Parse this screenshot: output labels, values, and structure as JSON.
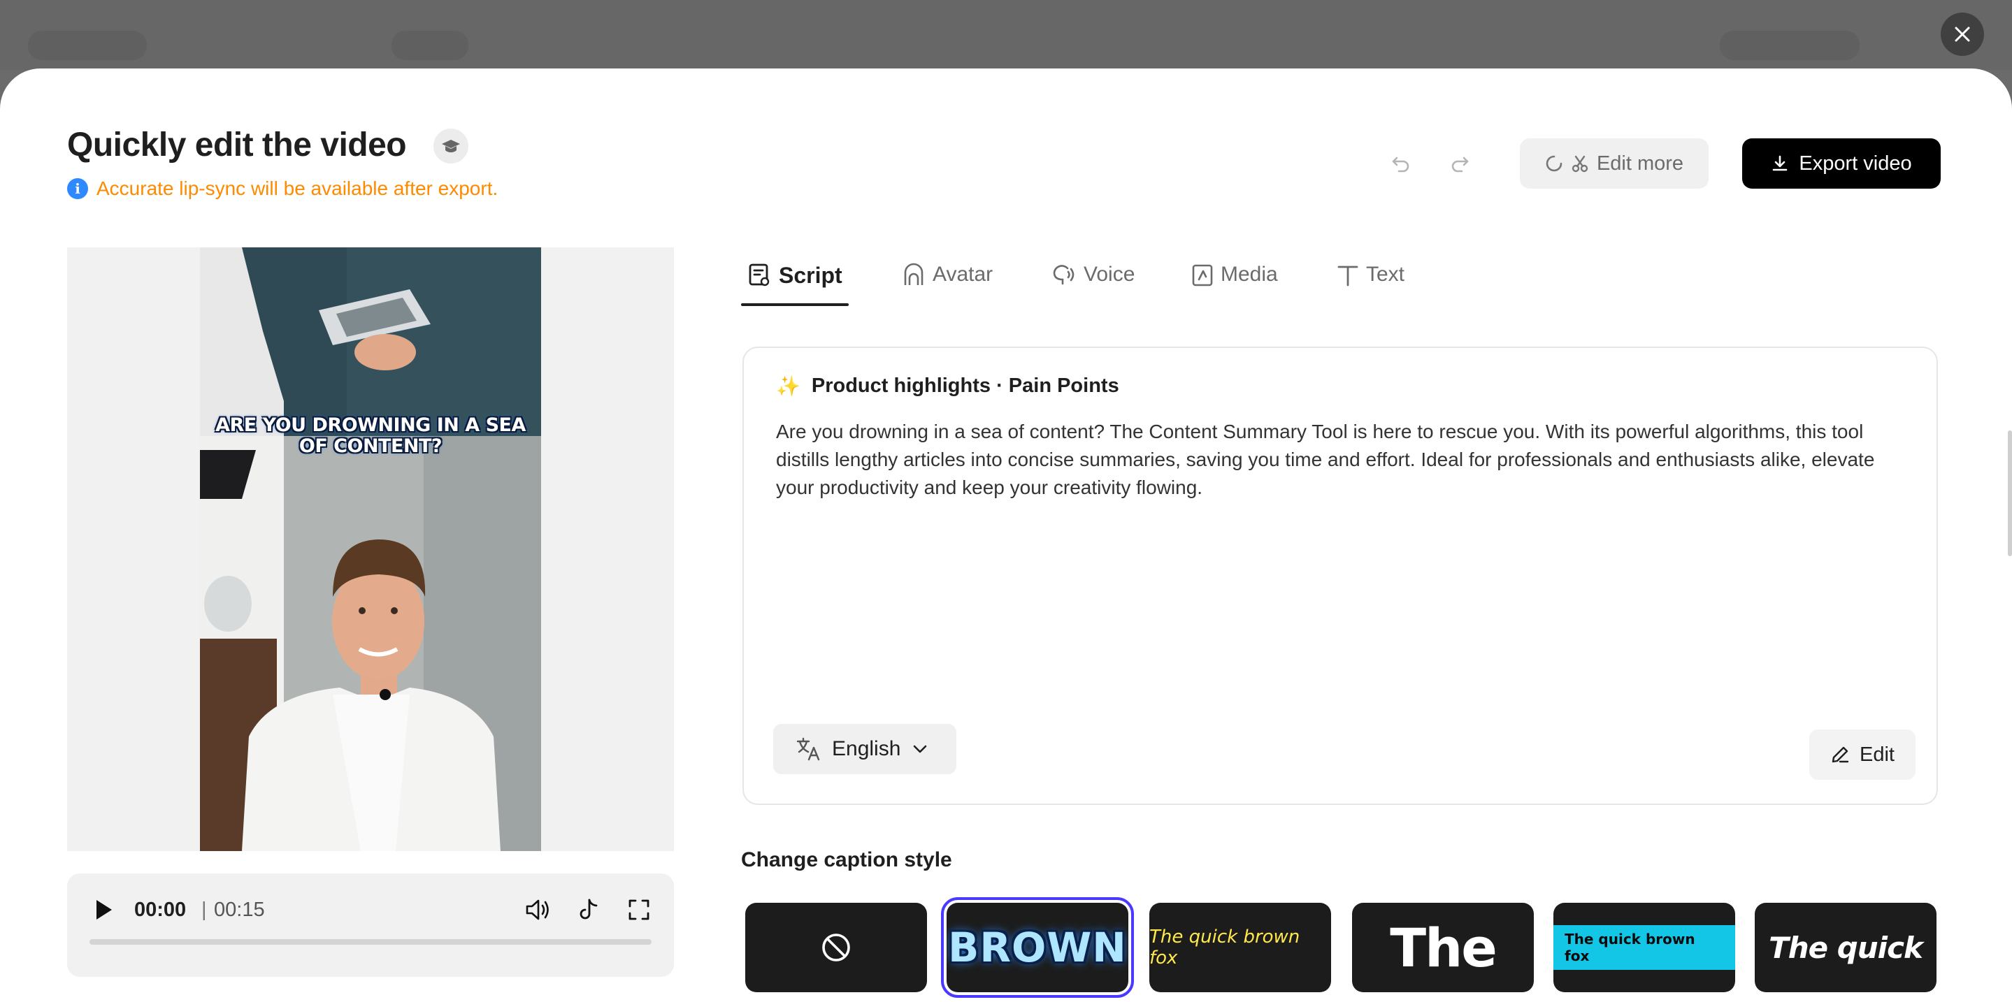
{
  "header": {
    "title": "Quickly edit the video",
    "notice": "Accurate lip-sync will be available after export.",
    "notice_icon": "info-icon",
    "edit_more_label": "Edit more",
    "export_label": "Export video"
  },
  "preview": {
    "caption": "ARE YOU DROWNING IN A SEA OF CONTENT?",
    "current_time": "00:00",
    "separator": "|",
    "duration": "00:15",
    "progress": 0
  },
  "tabs": [
    {
      "label": "Script",
      "icon": "script-icon",
      "active": true
    },
    {
      "label": "Avatar",
      "icon": "avatar-icon",
      "active": false
    },
    {
      "label": "Voice",
      "icon": "voice-icon",
      "active": false
    },
    {
      "label": "Media",
      "icon": "media-icon",
      "active": false
    },
    {
      "label": "Text",
      "icon": "text-icon",
      "active": false
    }
  ],
  "script": {
    "heading": "Product highlights · Pain Points",
    "heading_icon": "sparkle-icon",
    "body": "Are you drowning in a sea of content? The Content Summary Tool is here to rescue you. With its powerful algorithms, this tool distills lengthy articles into concise summaries, saving you time and effort. Ideal for professionals and enthusiasts alike, elevate your productivity and keep your creativity flowing.",
    "language": "English",
    "edit_label": "Edit"
  },
  "captions": {
    "section_title": "Change caption style",
    "styles": [
      {
        "label": "",
        "kind": "none"
      },
      {
        "label": "BROWN",
        "kind": "brown",
        "selected": true
      },
      {
        "label": "The quick brown fox",
        "kind": "yellow-italic"
      },
      {
        "label": "The",
        "kind": "bold-white"
      },
      {
        "label": "The quick brown fox",
        "kind": "cyan-box"
      },
      {
        "label": "The quick",
        "kind": "bold-italic"
      }
    ]
  },
  "colors": {
    "accent": "#000000",
    "notice": "#ff8a00",
    "info": "#2e88ff",
    "selected_outline": "#4a3aff"
  }
}
